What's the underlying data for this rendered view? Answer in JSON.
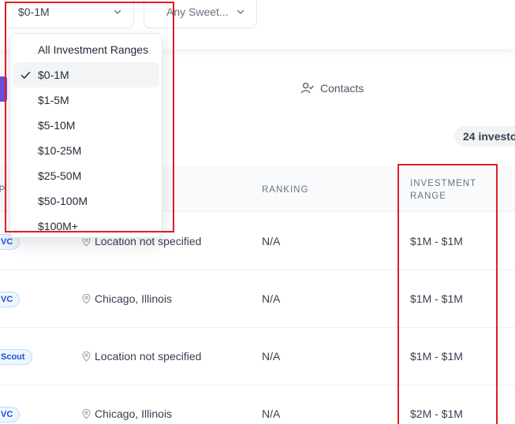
{
  "filters": {
    "range_select": {
      "value": "$0-1M"
    },
    "sweet_select": {
      "value": "Any Sweet..."
    }
  },
  "tabs": {
    "contacts_label": "Contacts"
  },
  "count_badge": "24 investo",
  "dropdown": {
    "options": [
      {
        "label": "All Investment Ranges",
        "selected": false
      },
      {
        "label": "$0-1M",
        "selected": true
      },
      {
        "label": "$1-5M",
        "selected": false
      },
      {
        "label": "$5-10M",
        "selected": false
      },
      {
        "label": "$10-25M",
        "selected": false
      },
      {
        "label": "$25-50M",
        "selected": false
      },
      {
        "label": "$50-100M",
        "selected": false
      },
      {
        "label": "$100M+",
        "selected": false
      }
    ]
  },
  "table": {
    "headers": {
      "type": "YP",
      "ranking": "RANKING",
      "range_line1": "INVESTMENT",
      "range_line2": "RANGE"
    },
    "rows": [
      {
        "type": "VC",
        "location": "Location not specified",
        "ranking": "N/A",
        "range": "$1M - $1M"
      },
      {
        "type": "VC",
        "location": "Chicago, Illinois",
        "ranking": "N/A",
        "range": "$1M - $1M"
      },
      {
        "type": "Scout",
        "location": "Location not specified",
        "ranking": "N/A",
        "range": "$1M - $1M"
      },
      {
        "type": "VC",
        "location": "Chicago, Illinois",
        "ranking": "N/A",
        "range": "$2M - $1M"
      }
    ]
  },
  "colors": {
    "highlight": "#e11d2a",
    "accent": "#6d4fe0",
    "badge_text": "#1d4ed8"
  },
  "icons": [
    "chevron-down-icon",
    "contacts-icon",
    "check-icon",
    "location-pin-icon"
  ]
}
